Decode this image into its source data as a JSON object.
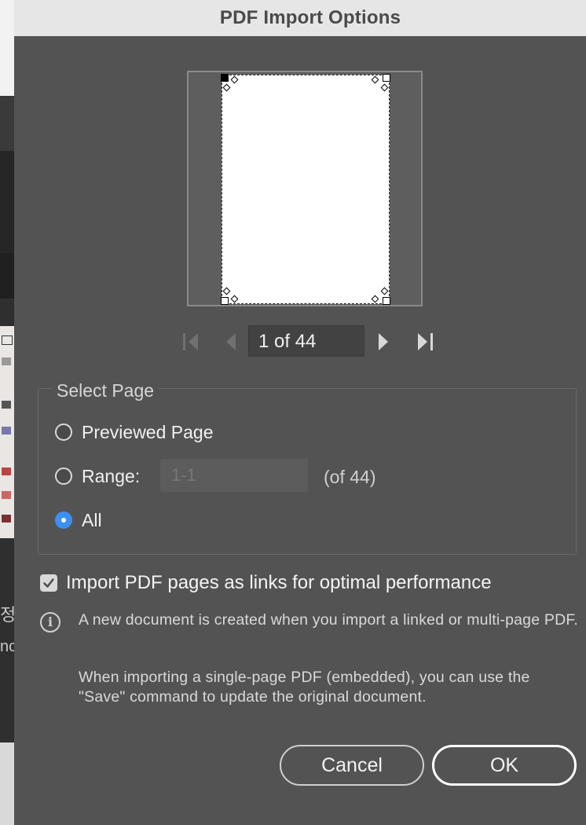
{
  "dialog": {
    "title": "PDF Import Options"
  },
  "pager": {
    "page_display": "1 of 44"
  },
  "select_page": {
    "group_title": "Select Page",
    "options": [
      {
        "label": "Previewed Page",
        "selected": false
      },
      {
        "label": "Range:",
        "selected": false
      },
      {
        "label": "All",
        "selected": true
      }
    ],
    "range_value": "1-1",
    "range_total": "(of 44)"
  },
  "link_option": {
    "label": "Import PDF pages as links for optimal performance",
    "checked": true
  },
  "info": {
    "paragraph_1": "A new document is created when you import a linked or multi-page PDF.",
    "paragraph_2": "When importing a single-page PDF (embedded), you can use the \"Save\" command to update the original document."
  },
  "buttons": {
    "cancel": "Cancel",
    "ok": "OK"
  },
  "background_app": {
    "text_1": "정",
    "text_2": "nc"
  },
  "colors": {
    "accent": "#3d8ff2",
    "dialog_bg": "#535353",
    "titlebar_bg": "#e6e6e6"
  }
}
